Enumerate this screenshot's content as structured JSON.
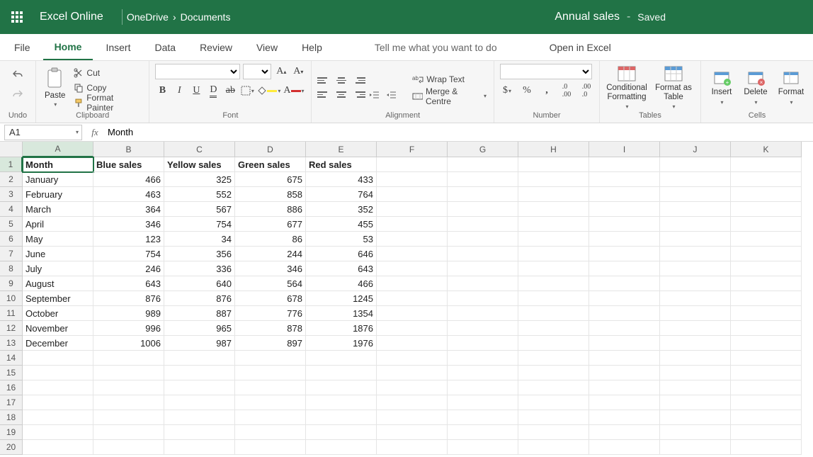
{
  "titlebar": {
    "app": "Excel Online",
    "breadcrumb": [
      "OneDrive",
      "Documents"
    ],
    "docname": "Annual sales",
    "status": "Saved"
  },
  "tabs": {
    "file": "File",
    "list": [
      "Home",
      "Insert",
      "Data",
      "Review",
      "View",
      "Help"
    ],
    "active": "Home",
    "tell": "Tell me what you want to do",
    "openexcel": "Open in Excel"
  },
  "ribbon": {
    "undo": "Undo",
    "clipboard": {
      "label": "Clipboard",
      "paste": "Paste",
      "cut": "Cut",
      "copy": "Copy",
      "painter": "Format Painter"
    },
    "font": {
      "label": "Font"
    },
    "alignment": {
      "label": "Alignment",
      "wrap": "Wrap Text",
      "merge": "Merge & Centre"
    },
    "number": {
      "label": "Number"
    },
    "tables": {
      "label": "Tables",
      "cond": "Conditional Formatting",
      "astable": "Format as Table"
    },
    "cells": {
      "label": "Cells",
      "insert": "Insert",
      "delete": "Delete",
      "format": "Format"
    }
  },
  "formulabar": {
    "namebox": "A1",
    "value": "Month"
  },
  "columns": [
    "A",
    "B",
    "C",
    "D",
    "E",
    "F",
    "G",
    "H",
    "I",
    "J",
    "K"
  ],
  "headers": [
    "Month",
    "Blue sales",
    "Yellow sales",
    "Green sales",
    "Red sales"
  ],
  "rows": [
    [
      "January",
      466,
      325,
      675,
      433
    ],
    [
      "February",
      463,
      552,
      858,
      764
    ],
    [
      "March",
      364,
      567,
      886,
      352
    ],
    [
      "April",
      346,
      754,
      677,
      455
    ],
    [
      "May",
      123,
      34,
      86,
      53
    ],
    [
      "June",
      754,
      356,
      244,
      646
    ],
    [
      "July",
      246,
      336,
      346,
      643
    ],
    [
      "August",
      643,
      640,
      564,
      466
    ],
    [
      "September",
      876,
      876,
      678,
      1245
    ],
    [
      "October",
      989,
      887,
      776,
      1354
    ],
    [
      "November",
      996,
      965,
      878,
      1876
    ],
    [
      "December",
      1006,
      987,
      897,
      1976
    ]
  ],
  "selected": {
    "row": 1,
    "col": "A"
  },
  "totalRows": 20
}
